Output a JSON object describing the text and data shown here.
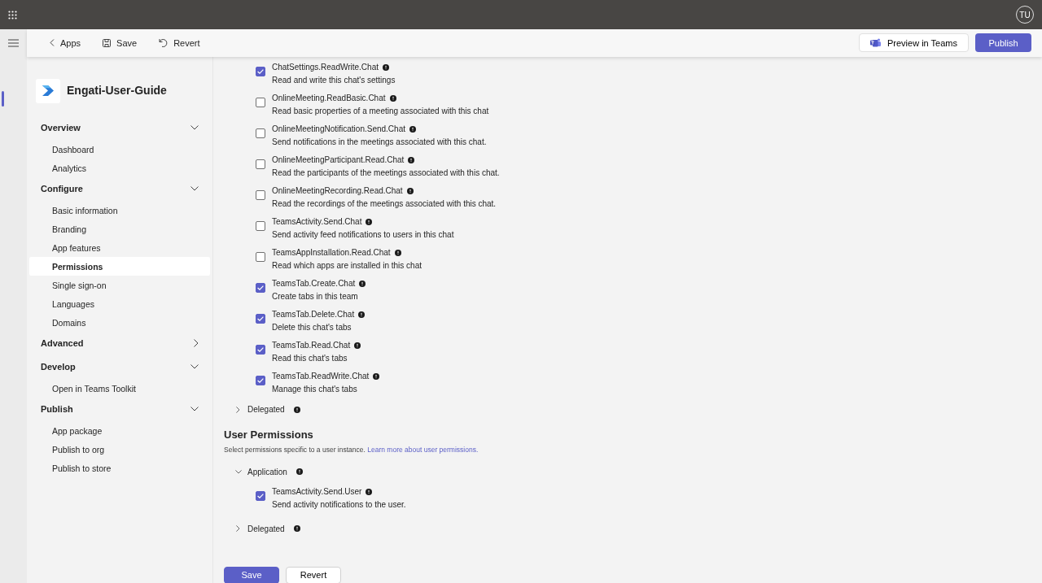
{
  "app_bar": {
    "avatar": "TU"
  },
  "toolbar": {
    "back": "Apps",
    "save": "Save",
    "revert": "Revert",
    "preview": "Preview in Teams",
    "publish": "Publish"
  },
  "app": {
    "name": "Engati-User-Guide"
  },
  "sidebar": {
    "sections": [
      {
        "label": "Overview",
        "expanded": true,
        "items": [
          {
            "label": "Dashboard",
            "selected": false
          },
          {
            "label": "Analytics",
            "selected": false
          }
        ]
      },
      {
        "label": "Configure",
        "expanded": true,
        "items": [
          {
            "label": "Basic information",
            "selected": false
          },
          {
            "label": "Branding",
            "selected": false
          },
          {
            "label": "App features",
            "selected": false
          },
          {
            "label": "Permissions",
            "selected": true
          },
          {
            "label": "Single sign-on",
            "selected": false
          },
          {
            "label": "Languages",
            "selected": false
          },
          {
            "label": "Domains",
            "selected": false
          }
        ]
      },
      {
        "label": "Advanced",
        "expanded": false
      },
      {
        "label": "Develop",
        "expanded": true,
        "items": [
          {
            "label": "Open in Teams Toolkit",
            "selected": false
          }
        ]
      },
      {
        "label": "Publish",
        "expanded": true,
        "items": [
          {
            "label": "App package",
            "selected": false
          },
          {
            "label": "Publish to org",
            "selected": false
          },
          {
            "label": "Publish to store",
            "selected": false
          }
        ]
      }
    ]
  },
  "chat_permissions": {
    "permissions": [
      {
        "name": "ChatSettings.ReadWrite.Chat",
        "description": "Read and write this chat's settings",
        "checked": true
      },
      {
        "name": "OnlineMeeting.ReadBasic.Chat",
        "description": "Read basic properties of a meeting associated with this chat",
        "checked": false
      },
      {
        "name": "OnlineMeetingNotification.Send.Chat",
        "description": "Send notifications in the meetings associated with this chat.",
        "checked": false
      },
      {
        "name": "OnlineMeetingParticipant.Read.Chat",
        "description": "Read the participants of the meetings associated with this chat.",
        "checked": false
      },
      {
        "name": "OnlineMeetingRecording.Read.Chat",
        "description": "Read the recordings of the meetings associated with this chat.",
        "checked": false
      },
      {
        "name": "TeamsActivity.Send.Chat",
        "description": "Send activity feed notifications to users in this chat",
        "checked": false
      },
      {
        "name": "TeamsAppInstallation.Read.Chat",
        "description": "Read which apps are installed in this chat",
        "checked": false
      },
      {
        "name": "TeamsTab.Create.Chat",
        "description": "Create tabs in this team",
        "checked": true
      },
      {
        "name": "TeamsTab.Delete.Chat",
        "description": "Delete this chat's tabs",
        "checked": true
      },
      {
        "name": "TeamsTab.Read.Chat",
        "description": "Read this chat's tabs",
        "checked": true
      },
      {
        "name": "TeamsTab.ReadWrite.Chat",
        "description": "Manage this chat's tabs",
        "checked": true
      }
    ],
    "groups": [
      {
        "label": "Delegated",
        "expanded": false
      }
    ]
  },
  "user_permissions": {
    "title": "User Permissions",
    "description": "Select permissions specific to a user instance.",
    "link": "Learn more about user permissions.",
    "groups": [
      {
        "label": "Application",
        "expanded": true,
        "permissions": [
          {
            "name": "TeamsActivity.Send.User",
            "description": "Send activity notifications to the user.",
            "checked": true
          }
        ]
      },
      {
        "label": "Delegated",
        "expanded": false
      }
    ]
  },
  "buttons": [
    {
      "label": "Save",
      "kind": "primary"
    },
    {
      "label": "Revert",
      "kind": "secondary"
    }
  ]
}
